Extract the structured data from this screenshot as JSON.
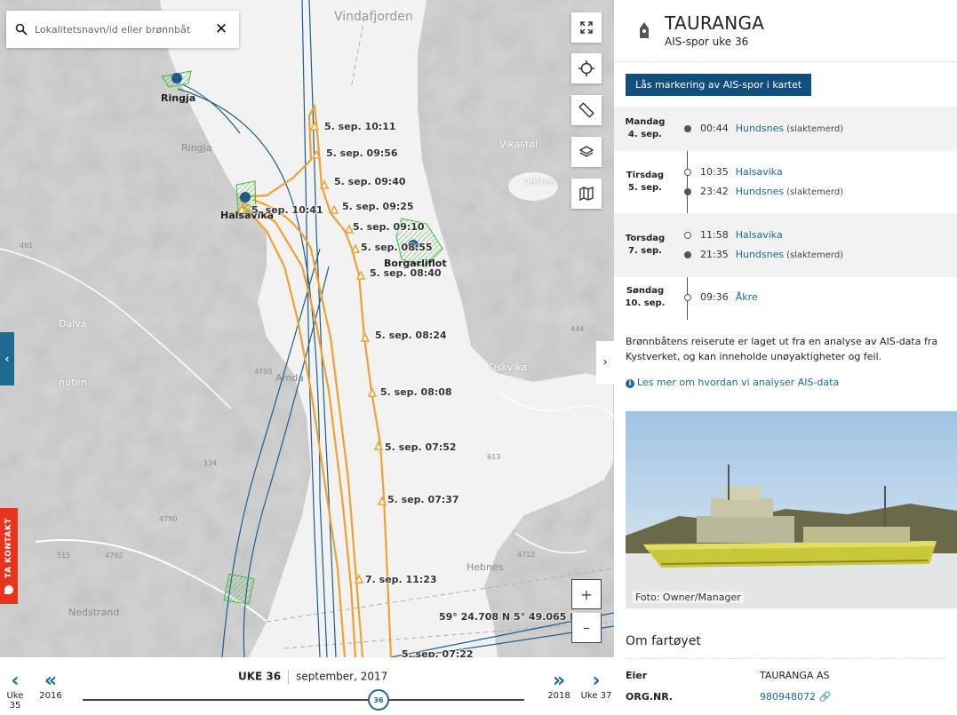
{
  "search": {
    "placeholder": "Lokalitetsnavn/id eller brønnbåt"
  },
  "map": {
    "places": {
      "vindafjorden": "Vindafjorden",
      "ringja_bold": "Ringja",
      "ringja": "Ringja",
      "vikastol": "Vikastøl",
      "vatnet": "vatnet",
      "halsavika": "Halsavika",
      "borgarliflot": "Borgarliflot",
      "dalva": "Dalva-",
      "nuten": "nuten",
      "amda": "Amda",
      "oskvika": "Oskvika",
      "hebnes": "Hebnes",
      "nedstrand": "Nedstrand",
      "road_4790": "4790",
      "road_4790b": "4790",
      "road_515": "515",
      "road_4792": "4792",
      "road_4712": "4712",
      "road_134": "134",
      "road_444": "444",
      "road_461": "461",
      "road_613": "613"
    },
    "track_labels": [
      "5. sep. 10:11",
      "5. sep. 09:56",
      "5. sep. 09:40",
      "5. sep. 10:41",
      "5. sep. 09:25",
      "5. sep. 09:10",
      "5. sep. 08:55",
      "5. sep. 08:40",
      "5. sep. 08:24",
      "5. sep. 08:08",
      "5. sep. 07:52",
      "5. sep. 07:37",
      "7. sep. 11:23",
      "5. sep. 07:22"
    ],
    "coordinate_readout": "59° 24.708 N 5° 49.065 E",
    "zoom_in": "+",
    "zoom_out": "–",
    "colors": {
      "track": "#f0a030",
      "route": "#1d5d8a",
      "site": "#3dbb3d",
      "marker": "#1d5a8a"
    }
  },
  "contact_tab": {
    "label": "TA KONTAKT"
  },
  "week_bar": {
    "prev_week": "Uke 35",
    "prev_year": "2016",
    "next_year": "2018",
    "next_week": "Uke 37",
    "week": "UKE 36",
    "month": "september, 2017",
    "knob": "36",
    "position": 0.67
  },
  "panel": {
    "vessel_name": "TAURANGA",
    "subtitle": "AIS-spor uke 36",
    "lock_button": "Lås markering av AIS-spor i kartet",
    "days": [
      {
        "day": "Mandag",
        "date": "4. sep.",
        "entries": [
          {
            "time": "00:44",
            "location": "Hundsnes",
            "kind": "(slaktemerd)",
            "filled": true
          }
        ]
      },
      {
        "day": "Tirsdag",
        "date": "5. sep.",
        "entries": [
          {
            "time": "10:35",
            "location": "Halsavika",
            "kind": "",
            "filled": false
          },
          {
            "time": "23:42",
            "location": "Hundsnes",
            "kind": "(slaktemerd)",
            "filled": true
          }
        ]
      },
      {
        "day": "Torsdag",
        "date": "7. sep.",
        "entries": [
          {
            "time": "11:58",
            "location": "Halsavika",
            "kind": "",
            "filled": false
          },
          {
            "time": "21:35",
            "location": "Hundsnes",
            "kind": "(slaktemerd)",
            "filled": true
          }
        ]
      },
      {
        "day": "Søndag",
        "date": "10. sep.",
        "entries": [
          {
            "time": "09:36",
            "location": "Åkre",
            "kind": "",
            "filled": false
          }
        ]
      }
    ],
    "disclaimer": "Brønnbåtens reiserute er laget ut fra en analyse av AIS-data fra Kystverket, og kan inneholde unøyaktigheter og feil.",
    "more_link": "Les mer om hvordan vi analyser AIS-data",
    "photo_credit": "Foto: Owner/Manager",
    "about_title": "Om fartøyet",
    "owner_label": "Eier",
    "owner_value": "TAURANGA AS",
    "org_label": "ORG.NR.",
    "org_value": "980948072"
  }
}
